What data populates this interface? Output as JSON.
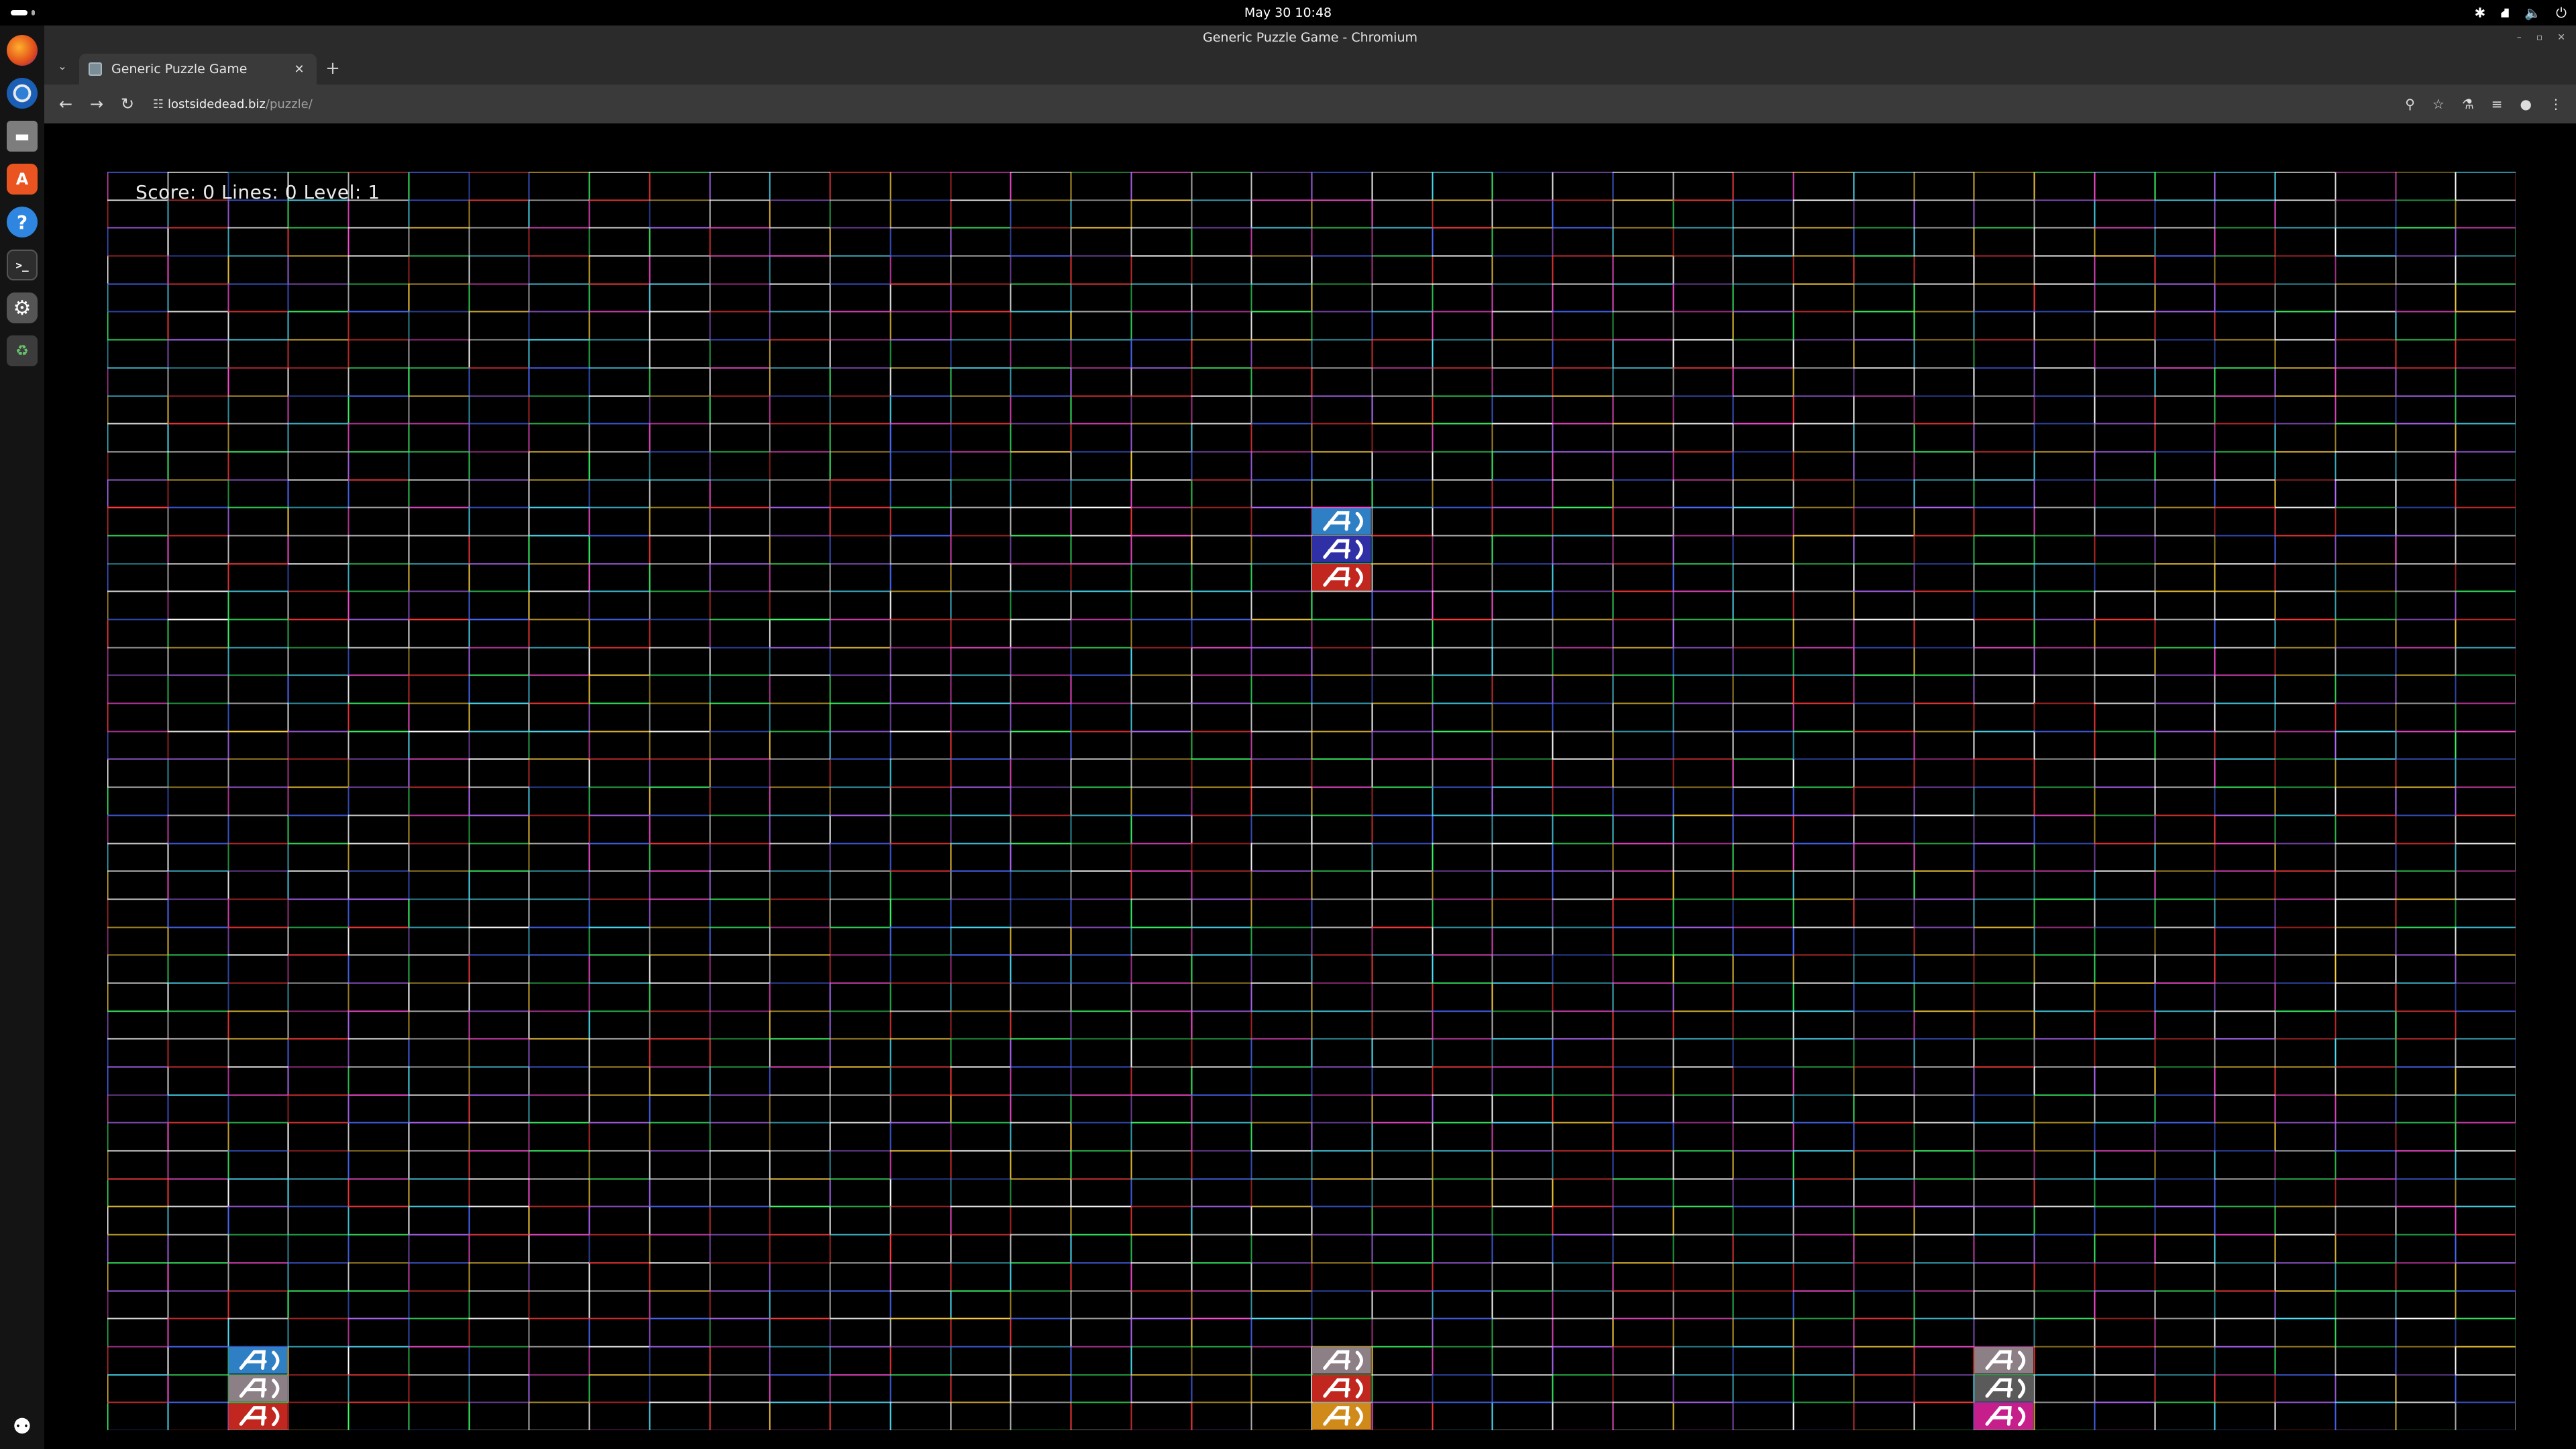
{
  "topbar": {
    "clock": "May 30  10:48",
    "tray_icons": [
      "accessibility-icon",
      "network-icon",
      "volume-icon",
      "power-icon"
    ]
  },
  "dock": {
    "apps": [
      "firefox",
      "chromium",
      "files",
      "app-center",
      "help",
      "terminal",
      "settings",
      "trash"
    ]
  },
  "window": {
    "title": "Generic Puzzle Game - Chromium"
  },
  "tab": {
    "title": "Generic Puzzle Game"
  },
  "omnibox": {
    "host": "lostsidedead.biz",
    "path": "/puzzle/"
  },
  "game": {
    "status": "Score: 0 Lines: 0 Level: 1",
    "grid": {
      "columns": 40,
      "rows": 45
    },
    "pieces": [
      {
        "col": 20,
        "row": 12,
        "color": "#2f7fc4"
      },
      {
        "col": 20,
        "row": 13,
        "color": "#2f2fa6"
      },
      {
        "col": 20,
        "row": 14,
        "color": "#c1261f"
      },
      {
        "col": 2,
        "row": 42,
        "color": "#2f7fc4"
      },
      {
        "col": 2,
        "row": 43,
        "color": "#8c7f86"
      },
      {
        "col": 2,
        "row": 44,
        "color": "#c1261f"
      },
      {
        "col": 20,
        "row": 42,
        "color": "#8c7f86"
      },
      {
        "col": 20,
        "row": 43,
        "color": "#c1261f"
      },
      {
        "col": 20,
        "row": 44,
        "color": "#d08a1a"
      },
      {
        "col": 31,
        "row": 42,
        "color": "#8c7f86"
      },
      {
        "col": 31,
        "row": 43,
        "color": "#5a5a5a"
      },
      {
        "col": 31,
        "row": 44,
        "color": "#c61f8c"
      }
    ]
  }
}
